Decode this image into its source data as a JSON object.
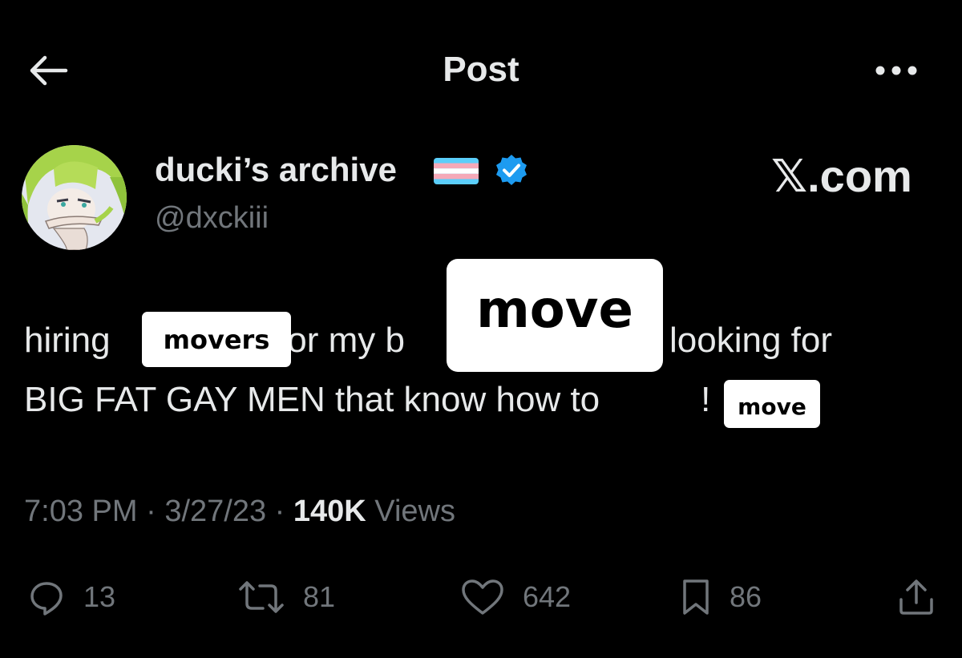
{
  "header": {
    "title": "Post"
  },
  "author": {
    "display_name": "ducki’s archive",
    "handle": "@dxckiii"
  },
  "watermark": "𝕏.com",
  "tweet": {
    "line1_a": "hiring ",
    "line1_b": " for my b",
    "line1_c": "looking for",
    "line2": "BIG FAT GAY MEN that know how to",
    "line2_end": "!",
    "stickers": [
      "movers",
      "move",
      "move"
    ]
  },
  "meta": {
    "time": "7:03 PM",
    "sep1": " · ",
    "date": "3/27/23",
    "sep2": " · ",
    "views_count": "140K",
    "views_label": " Views"
  },
  "actions": {
    "replies": "13",
    "reposts": "81",
    "likes": "642",
    "bookmarks": "86"
  },
  "colors": {
    "background": "#000000",
    "text": "#e7e9ea",
    "muted": "#71767b",
    "verified": "#1d9bf0",
    "flag_blue": "#5bcefa",
    "flag_pink": "#f5a9b8"
  },
  "icons": [
    "back-arrow-icon",
    "more-icon",
    "verified-icon",
    "trans-flag-icon",
    "reply-icon",
    "repost-icon",
    "like-icon",
    "bookmark-icon",
    "share-icon"
  ]
}
